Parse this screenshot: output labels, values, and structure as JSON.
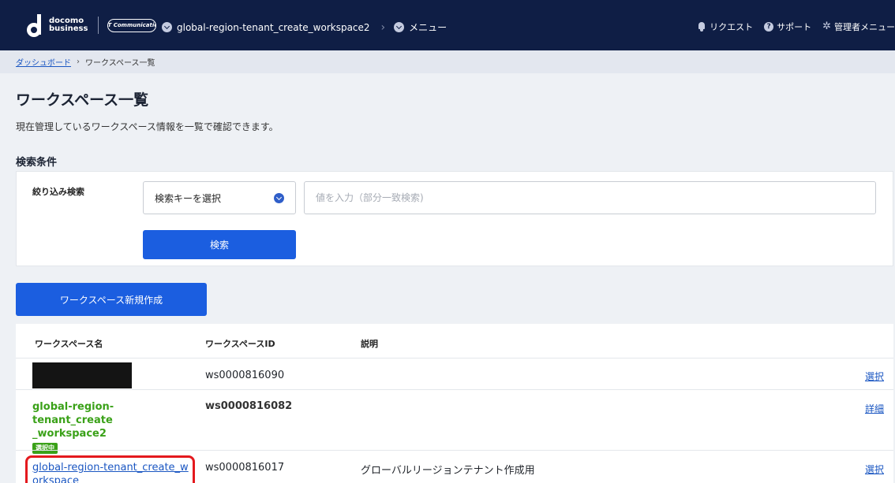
{
  "header": {
    "brand_line1": "docomo",
    "brand_line2": "business",
    "partner_logo": "NTT Communications",
    "workspace_name": "global-region-tenant_create_workspace2",
    "menu_label": "メニュー",
    "nav": [
      {
        "label": "リクエスト",
        "icon": "bell-icon"
      },
      {
        "label": "サポート",
        "icon": "help-icon"
      },
      {
        "label": "管理者メニュー",
        "icon": "gear-icon"
      }
    ]
  },
  "breadcrumb": {
    "dashboard": "ダッシュボード",
    "current": "ワークスペース一覧"
  },
  "page": {
    "title": "ワークスペース一覧",
    "description": "現在管理しているワークスペース情報を一覧で確認できます。",
    "search_section_title": "検索条件"
  },
  "search": {
    "filter_label": "絞り込み検索",
    "key_select_value": "検索キーを選択",
    "value_placeholder": "値を入力（部分一致検索)",
    "search_button": "検索"
  },
  "create_button": "ワークスペース新規作成",
  "table": {
    "headers": {
      "name": "ワークスペース名",
      "id": "ワークスペースID",
      "description": "説明"
    },
    "rows": [
      {
        "name": "",
        "id": "ws0000816090",
        "description": "",
        "action": "選択"
      },
      {
        "name": "global-region-tenant_create_workspace2",
        "name_display_line1": "global-region-tenant_create",
        "name_display_line2": "_workspace2",
        "badge": "選択中",
        "id": "ws0000816082",
        "description": "",
        "action": "詳細"
      },
      {
        "name": "global-region-tenant_create_workspace",
        "name_display_line1": "global-region-tenant_create_w",
        "name_display_line2": "orkspace",
        "id": "ws0000816017",
        "description": "グローバルリージョンテナント作成用",
        "action": "選択"
      }
    ]
  },
  "colors": {
    "header_bg": "#0f1e45",
    "primary_button": "#1b5ee0",
    "link": "#1a56c2",
    "current_green": "#3aa118",
    "highlight_red": "#e4191e"
  }
}
